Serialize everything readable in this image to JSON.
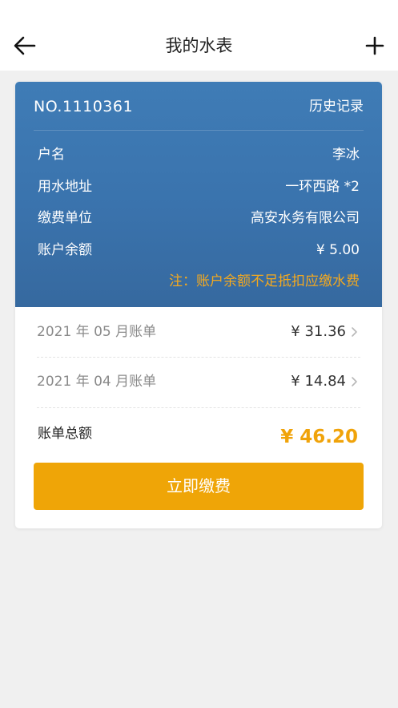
{
  "header": {
    "title": "我的水表",
    "back_icon": "arrow-left-icon",
    "add_icon": "plus-icon"
  },
  "meter": {
    "number": "NO.1110361",
    "history_label": "历史记录",
    "rows": [
      {
        "key": "户名",
        "value": "李冰"
      },
      {
        "key": "用水地址",
        "value": "一环西路 *2"
      },
      {
        "key": "缴费单位",
        "value": "高安水务有限公司"
      },
      {
        "key": "账户余额",
        "value": "¥ 5.00"
      }
    ],
    "warning": "注：账户余额不足抵扣应缴水费"
  },
  "bills": [
    {
      "label": "2021 年 05 月账单",
      "amount": "¥ 31.36"
    },
    {
      "label": "2021 年 04 月账单",
      "amount": "¥ 14.84"
    }
  ],
  "total": {
    "label": "账单总额",
    "amount": "¥ 46.20"
  },
  "pay_button_label": "立即缴费",
  "colors": {
    "card_header": "#3a73ad",
    "accent": "#efa507",
    "warning": "#f4a91f"
  }
}
